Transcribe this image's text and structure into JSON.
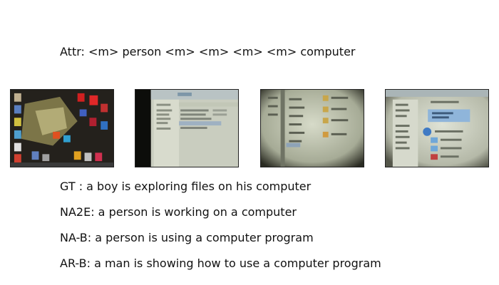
{
  "attr_line": "Attr: <m> person <m> <m> <m> <m> computer",
  "frames": [
    {
      "name": "video-frame-desktop"
    },
    {
      "name": "video-frame-file-explorer-1"
    },
    {
      "name": "video-frame-file-explorer-2"
    },
    {
      "name": "video-frame-file-explorer-3"
    }
  ],
  "captions": {
    "gt": "GT  : a boy is exploring files on his computer",
    "na2e": "NA2E: a person is working on a computer",
    "nab": "NA-B: a person is using a computer program",
    "arb": "AR-B: a man is showing how to use a computer program"
  }
}
